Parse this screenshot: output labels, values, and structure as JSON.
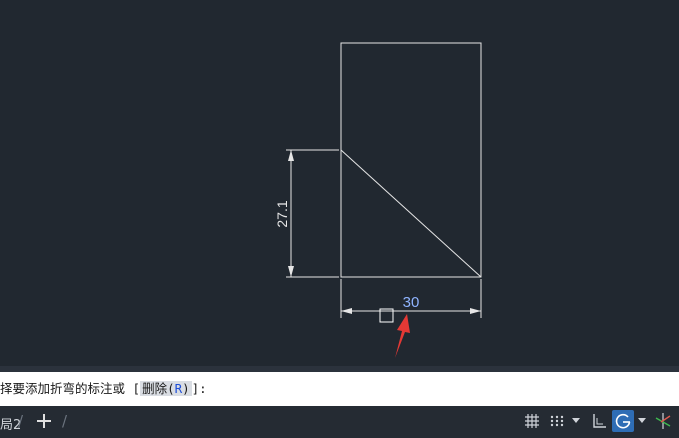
{
  "drawing": {
    "dimension_vertical": "27.1",
    "dimension_horizontal": "30",
    "colors": {
      "background": "#212830",
      "geometry": "#e6e6e6",
      "dimension_text_highlight": "#8fb4ff",
      "arrow": "#e53935"
    }
  },
  "command_line": {
    "prompt": "择要添加折弯的标注或 [",
    "option": "删除(R)",
    "option_text": "删除(",
    "option_key": "R",
    "option_close": ")",
    "suffix": "]:"
  },
  "status_bar": {
    "layout_tab": "局2",
    "icons": [
      "grid-icon",
      "snap-icon",
      "dropdown-icon",
      "ortho-icon",
      "polar-tracking-icon",
      "dropdown-icon",
      "isometric-icon"
    ]
  }
}
